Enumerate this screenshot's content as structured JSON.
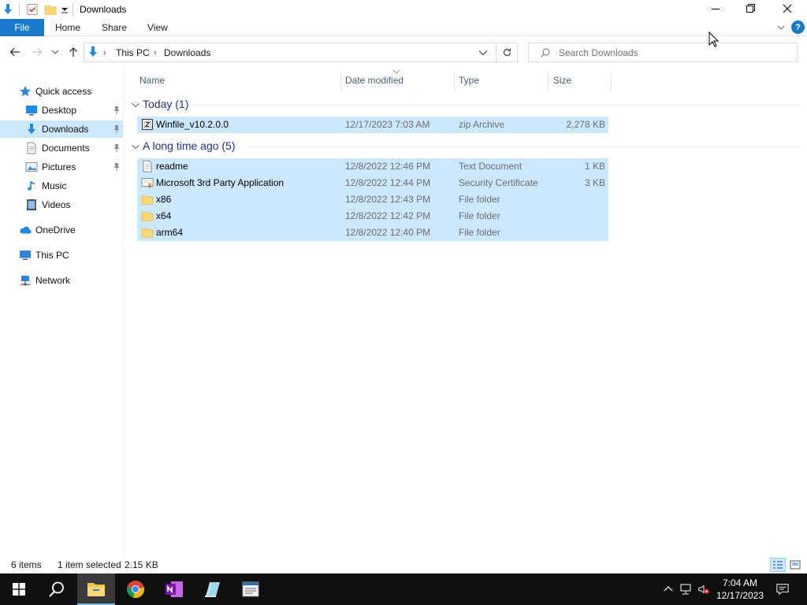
{
  "window": {
    "title": "Downloads",
    "icons": [
      "downloads-arrow-icon",
      "properties-icon",
      "new-folder-icon",
      "customize-chevron-icon"
    ]
  },
  "ribbon": {
    "tabs": [
      {
        "label": "File"
      },
      {
        "label": "Home"
      },
      {
        "label": "Share"
      },
      {
        "label": "View"
      }
    ],
    "help": "?"
  },
  "address": {
    "crumbs": [
      "This PC",
      "Downloads"
    ]
  },
  "search": {
    "placeholder": "Search Downloads"
  },
  "navpane": {
    "items": [
      {
        "label": "Quick access",
        "icon": "star-icon"
      },
      {
        "label": "Desktop",
        "icon": "desktop-icon",
        "pinned": true
      },
      {
        "label": "Downloads",
        "icon": "downloads-icon",
        "pinned": true,
        "selected": true
      },
      {
        "label": "Documents",
        "icon": "documents-icon",
        "pinned": true
      },
      {
        "label": "Pictures",
        "icon": "pictures-icon",
        "pinned": true
      },
      {
        "label": "Music",
        "icon": "music-icon"
      },
      {
        "label": "Videos",
        "icon": "videos-icon"
      },
      {
        "label": "OneDrive",
        "icon": "onedrive-icon"
      },
      {
        "label": "This PC",
        "icon": "this-pc-icon"
      },
      {
        "label": "Network",
        "icon": "network-icon"
      }
    ]
  },
  "columns": {
    "name": "Name",
    "date": "Date modified",
    "type": "Type",
    "size": "Size"
  },
  "groups": [
    {
      "label": "Today (1)",
      "files": [
        {
          "name": "Winfile_v10.2.0.0",
          "date": "12/17/2023 7:03 AM",
          "type": "zip Archive",
          "size": "2,278 KB",
          "icon": "zip-archive-icon"
        }
      ]
    },
    {
      "label": "A long time ago (5)",
      "files": [
        {
          "name": "readme",
          "date": "12/8/2022 12:46 PM",
          "type": "Text Document",
          "size": "1 KB",
          "icon": "text-document-icon"
        },
        {
          "name": "Microsoft 3rd Party Application",
          "date": "12/8/2022 12:44 PM",
          "type": "Security Certificate",
          "size": "3 KB",
          "icon": "certificate-icon"
        },
        {
          "name": "x86",
          "date": "12/8/2022 12:43 PM",
          "type": "File folder",
          "size": "",
          "icon": "folder-icon"
        },
        {
          "name": "x64",
          "date": "12/8/2022 12:42 PM",
          "type": "File folder",
          "size": "",
          "icon": "folder-icon"
        },
        {
          "name": "arm64",
          "date": "12/8/2022 12:40 PM",
          "type": "File folder",
          "size": "",
          "icon": "folder-icon"
        }
      ]
    }
  ],
  "status": {
    "count": "6 items",
    "selection": "1 item selected",
    "size": "2.15 KB"
  },
  "taskbar": {
    "apps": [
      "start-icon",
      "search-icon",
      "file-explorer-icon",
      "chrome-icon",
      "onenote-icon",
      "notepad-icon",
      "app-icon"
    ],
    "time": "7:04 AM",
    "date": "12/17/2023"
  },
  "colors": {
    "accent": "#1979ca",
    "selection": "#cce8ff",
    "group_header": "#1e3287",
    "taskbar": "#101010"
  }
}
